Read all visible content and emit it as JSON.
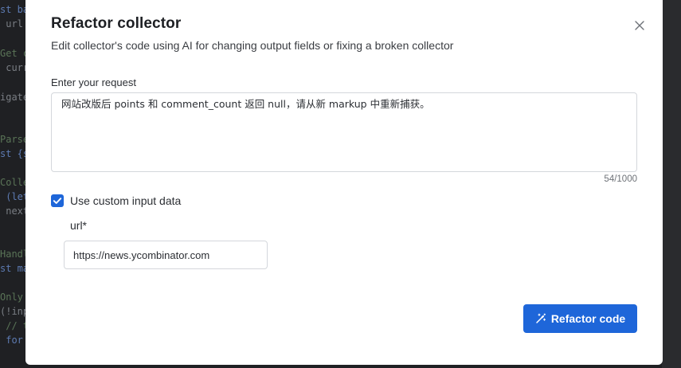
{
  "background": {
    "code_lines": [
      {
        "text": "st ba",
        "cls": "kw"
      },
      {
        "text": " url",
        "cls": "nm"
      },
      {
        "text": "Get c",
        "cls": "cm"
      },
      {
        "text": " curr",
        "cls": "nm"
      },
      {
        "text": "igate",
        "cls": "nm"
      },
      {
        "text": "Parse",
        "cls": "cm"
      },
      {
        "text": "st {s",
        "cls": "kw"
      },
      {
        "text": "Colle",
        "cls": "cm"
      },
      {
        "text": " (let",
        "cls": "kw"
      },
      {
        "text": " next",
        "cls": "nm"
      },
      {
        "text": "Handl",
        "cls": "cm"
      },
      {
        "text": "st ma",
        "cls": "kw"
      },
      {
        "text": "Only",
        "cls": "cm"
      },
      {
        "text": "(!inp",
        "cls": "nm"
      },
      {
        "text": " // t",
        "cls": "cm"
      },
      {
        "text": " for",
        "cls": "kw"
      }
    ]
  },
  "modal": {
    "title": "Refactor collector",
    "subtitle": "Edit collector's code using AI for changing output fields or fixing a broken collector",
    "request_label": "Enter your request",
    "request_value": "网站改版后 points 和 comment_count 返回 null，请从新 markup 中重新捕获。",
    "char_counter": "54/1000",
    "custom_input": {
      "checked": true,
      "label": "Use custom input data"
    },
    "url_field": {
      "label": "url*",
      "value": "https://news.ycombinator.com"
    },
    "submit_label": "Refactor code",
    "accent_color": "#1e66d9"
  }
}
